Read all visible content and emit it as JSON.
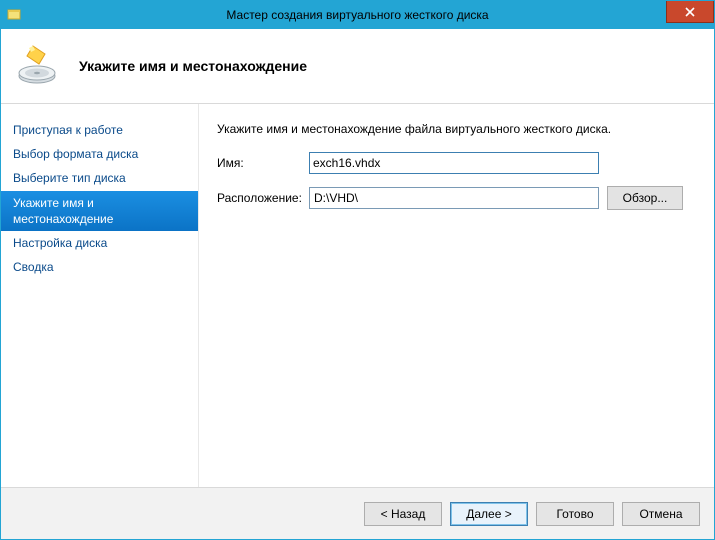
{
  "window": {
    "title": "Мастер создания виртуального жесткого диска"
  },
  "header": {
    "title": "Укажите имя и местонахождение"
  },
  "sidebar": {
    "steps": [
      "Приступая к работе",
      "Выбор формата диска",
      "Выберите тип диска",
      "Укажите имя и местонахождение",
      "Настройка диска",
      "Сводка"
    ],
    "active_index": 3
  },
  "content": {
    "description": "Укажите имя и местонахождение файла виртуального жесткого диска.",
    "name_label": "Имя:",
    "name_value": "exch16.vhdx",
    "location_label": "Расположение:",
    "location_value": "D:\\VHD\\",
    "browse_label": "Обзор..."
  },
  "footer": {
    "back": "< Назад",
    "next": "Далее >",
    "finish": "Готово",
    "cancel": "Отмена"
  }
}
